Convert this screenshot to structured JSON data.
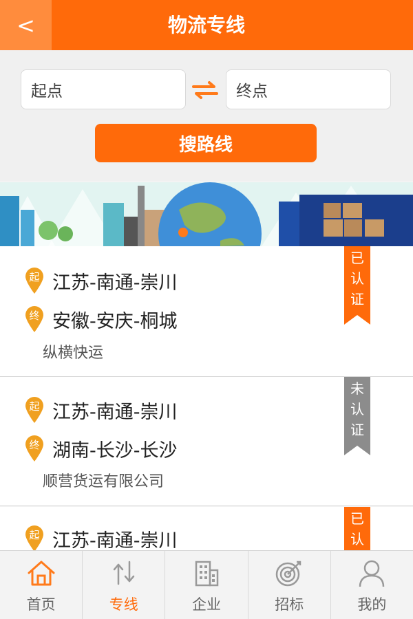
{
  "header": {
    "back_label": "<",
    "title": "物流专线"
  },
  "search": {
    "start_placeholder": "起点",
    "end_placeholder": "终点",
    "button_label": "搜路线"
  },
  "pins": {
    "start": "起",
    "end": "终"
  },
  "routes": [
    {
      "from": "江苏-南通-崇川",
      "to": "安徽-安庆-桐城",
      "company": "纵横快运",
      "status_chars": [
        "已",
        "认",
        "证"
      ],
      "certified": true
    },
    {
      "from": "江苏-南通-崇川",
      "to": "湖南-长沙-长沙",
      "company": "顺营货运有限公司",
      "status_chars": [
        "未",
        "认",
        "证"
      ],
      "certified": false
    },
    {
      "from": "江苏-南通-崇川",
      "status_chars": [
        "已",
        "认"
      ],
      "certified": true
    }
  ],
  "nav": [
    {
      "label": "首页",
      "icon": "home-icon"
    },
    {
      "label": "专线",
      "icon": "route-arrows-icon",
      "active": true
    },
    {
      "label": "企业",
      "icon": "building-icon"
    },
    {
      "label": "招标",
      "icon": "target-icon"
    },
    {
      "label": "我的",
      "icon": "user-icon"
    }
  ],
  "colors": {
    "brand": "#ff6a0a",
    "certified": "#ff6a0a",
    "uncertified": "#8c8c8c"
  }
}
